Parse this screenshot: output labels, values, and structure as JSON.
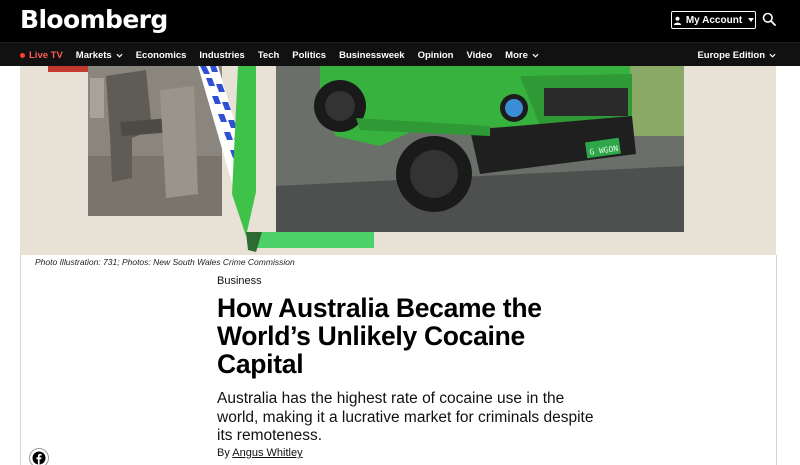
{
  "header": {
    "logo_text": "Bloomberg",
    "account_label": "My Account",
    "icons": {
      "account": "person-icon",
      "dropdown": "caret-down-icon",
      "search": "search-icon"
    }
  },
  "nav": {
    "live_tv": "Live TV",
    "items": [
      "Markets",
      "Economics",
      "Industries",
      "Tech",
      "Politics",
      "Businessweek",
      "Opinion",
      "Video",
      "More"
    ],
    "edition": "Europe Edition",
    "live_color": "#ff3b30"
  },
  "hero": {
    "plate_text": "G WGON",
    "caption": "Photo Illustration: 731; Photos: New South Wales Crime Commission"
  },
  "article": {
    "section": "Business",
    "headline": "How Australia Became the World’s Unlikely Cocaine Capital",
    "dek": "Australia has the highest rate of cocaine use in the world, making it a lucrative market for criminals despite its remoteness.",
    "byline_prefix": "By",
    "author": "Angus Whitley"
  },
  "share": {
    "facebook_icon": "facebook-icon"
  },
  "colors": {
    "topbar_bg": "#000000",
    "navbar_bg": "#111111",
    "accent_green": "#3fc24a"
  }
}
